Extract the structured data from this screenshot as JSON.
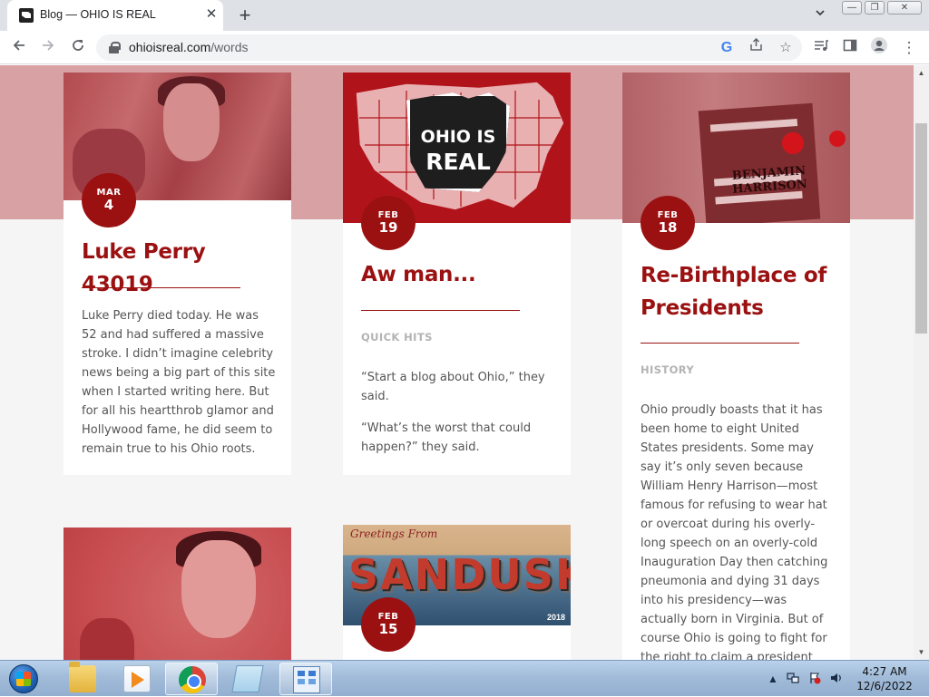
{
  "browser": {
    "tab_title": "Blog — OHIO IS REAL",
    "tab_close": "✕",
    "new_tab": "+",
    "url_host": "ohioisreal.com",
    "url_path": "/words",
    "google_icon_text": "G"
  },
  "window_controls": {
    "minimize": "—",
    "maximize": "❐",
    "close": "✕"
  },
  "posts": [
    {
      "month": "MAR",
      "day": "4",
      "title": "Luke Perry 43019",
      "category": "",
      "paragraphs": [
        "Luke Perry died today. He was 52 and had suffered a massive stroke. I didn’t imagine celebrity news being a big part of this site when I started writing here. But for all his heartthrob glamor and Hollywood fame, he did seem to remain true to his Ohio roots."
      ]
    },
    {
      "month": "FEB",
      "day": "19",
      "title": "Aw man...",
      "category": "QUICK HITS",
      "badge_line1": "OHIO IS",
      "badge_line2": "REAL",
      "paragraphs": [
        "“Start a blog about Ohio,” they said.",
        "“What’s the worst that could happen?” they said."
      ]
    },
    {
      "month": "FEB",
      "day": "18",
      "title_line1": "Re-Birthplace of",
      "title_line2": "Presidents",
      "category": "HISTORY",
      "book_text": "BENJAMIN HARRISON",
      "paragraphs": [
        "Ohio proudly boasts that it has been home to eight United States presidents. Some may say it’s only seven because William Henry Harrison—most famous for refusing to wear hat or overcoat during his overly-long speech on an overly-cold Inauguration Day then catching pneumonia and dying 31 days into his presidency—was actually born in Virginia. But of course Ohio is going to fight for the right to claim a president who literally didn’t have the sense to"
      ]
    },
    {
      "month": "FEB",
      "day": "15",
      "greeting": "Greetings From",
      "postcard_word": "SANDUSKY",
      "postcard_year": "2018"
    }
  ],
  "taskbar": {
    "time": "4:27 AM",
    "date": "12/6/2022"
  },
  "colors": {
    "brand_red": "#9b1111",
    "pink_band": "#d8a1a3",
    "page_bg": "#f5f5f5"
  }
}
